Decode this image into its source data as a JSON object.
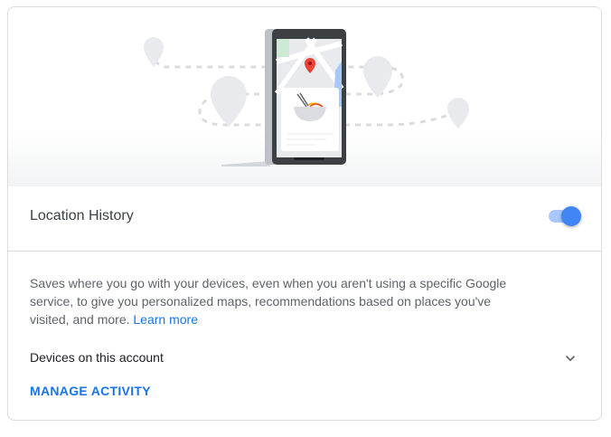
{
  "setting": {
    "title": "Location History",
    "enabled": true
  },
  "description": {
    "text": "Saves where you go with your devices, even when you aren't using a specific Google service, to give you personalized maps, recommendations based on places you've visited, and more.",
    "learn_more": "Learn more"
  },
  "devices": {
    "label": "Devices on this account"
  },
  "manage_activity": "MANAGE ACTIVITY",
  "colors": {
    "accent": "#1a73e8",
    "toggle_on": "#4285f4",
    "map_pin": "#ea4335"
  }
}
